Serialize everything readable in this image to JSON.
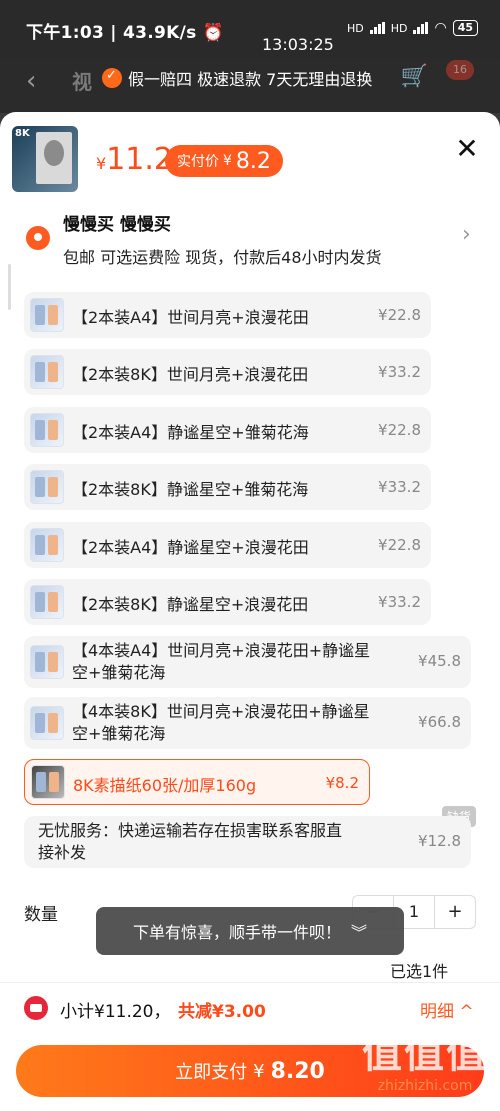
{
  "status_bar": {
    "left": "下午1:03 | 43.9K/s ⏰",
    "clock": "13:03:25",
    "battery": "45",
    "signal1": "HD",
    "signal2": "HD"
  },
  "background_page": {
    "title": "视",
    "guarantee": "假一赔四  极速退款  7天无理由退换",
    "cart_badge": "16"
  },
  "sheet": {
    "price": "11.2",
    "price_yen": "¥",
    "paid_label": "实付价",
    "paid_yen": "¥",
    "paid_amount": "8.2",
    "close": "✕"
  },
  "address": {
    "name": "慢慢买 慢慢买",
    "info": "包邮  可选运费险  现货，付款后48小时内发货"
  },
  "options": [
    {
      "name": "【2本装A4】世间月亮+浪漫花田",
      "price": "¥22.8"
    },
    {
      "name": "【2本装8K】世间月亮+浪漫花田",
      "price": "¥33.2"
    },
    {
      "name": "【2本装A4】静谧星空+雏菊花海",
      "price": "¥22.8"
    },
    {
      "name": "【2本装8K】静谧星空+雏菊花海",
      "price": "¥33.2"
    },
    {
      "name": "【2本装A4】静谧星空+浪漫花田",
      "price": "¥22.8"
    },
    {
      "name": "【2本装8K】静谧星空+浪漫花田",
      "price": "¥33.2"
    },
    {
      "name": "【4本装A4】世间月亮+浪漫花田+静谧星空+雏菊花海",
      "price": "¥45.8"
    },
    {
      "name": "【4本装8K】世间月亮+浪漫花田+静谧星空+雏菊花海",
      "price": "¥66.8"
    },
    {
      "name": "8K素描纸60张/加厚160g",
      "price": "¥8.2"
    }
  ],
  "service": {
    "name": "无忧服务：快递运输若存在损害联系客服直接补发",
    "price": "¥12.8",
    "tag": "缺货"
  },
  "quantity": {
    "label": "数量",
    "value": "1",
    "minus": "−",
    "plus": "+",
    "selected": "已选1件"
  },
  "toast": {
    "text": "下单有惊喜，顺手带一件呗！",
    "chevron": "︾"
  },
  "footer": {
    "subtotal": "小计¥11.20，",
    "discount": "共减¥3.00",
    "detail": "明细 ^",
    "pay_label": "立即支付",
    "pay_yen": "¥",
    "pay_amount": "8.20"
  },
  "watermark": {
    "big": "值值值",
    "small": "zhizhizhi.com"
  },
  "colors": {
    "accent": "#ff5a1f",
    "price": "#ff4a1a"
  }
}
